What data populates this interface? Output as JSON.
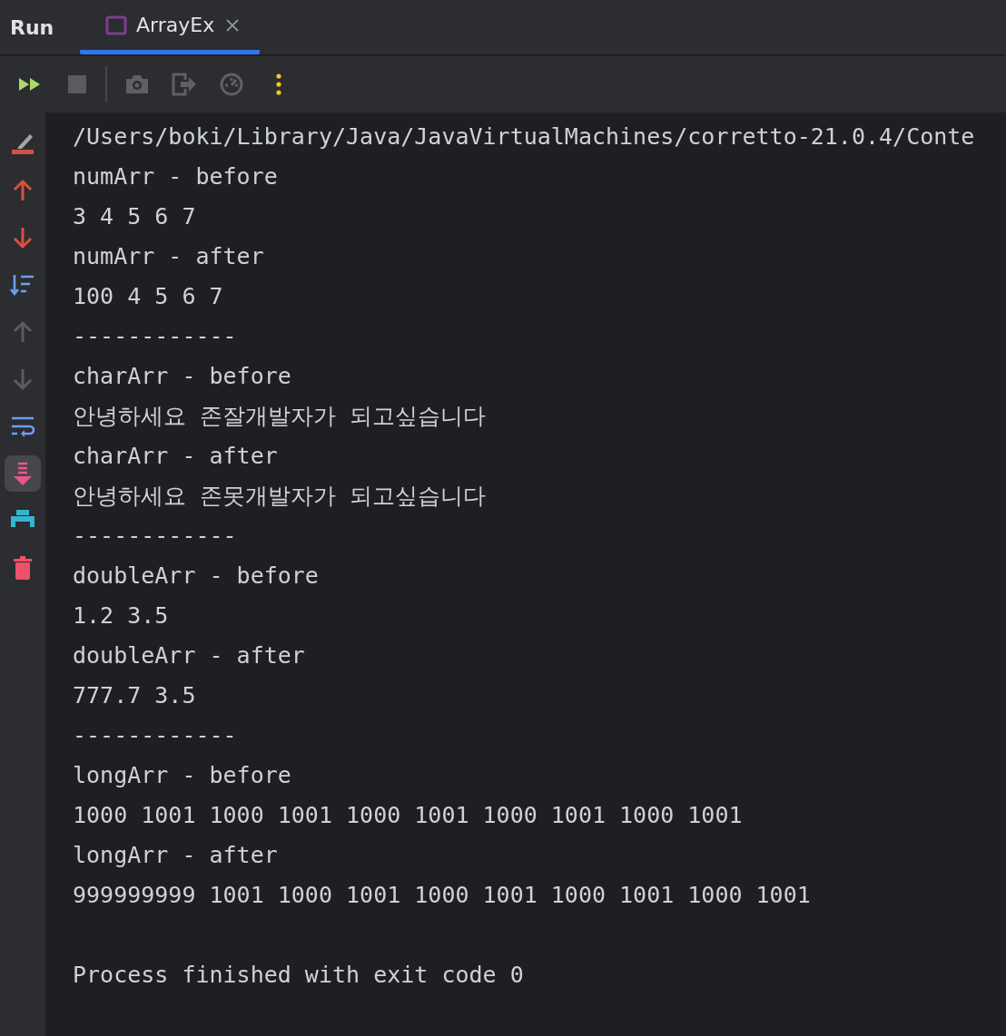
{
  "header": {
    "title": "Run",
    "tabs": [
      {
        "label": "ArrayEx",
        "selected": true
      }
    ]
  },
  "toolbar": [
    {
      "kind": "rerun",
      "disabled": false
    },
    {
      "kind": "stop",
      "disabled": true
    },
    {
      "kind": "camera",
      "disabled": true
    },
    {
      "kind": "exit",
      "disabled": true
    },
    {
      "kind": "gauge",
      "disabled": true
    },
    {
      "kind": "more",
      "disabled": false
    }
  ],
  "sidebar": [
    {
      "kind": "clear-marker",
      "disabled": false,
      "selected": false
    },
    {
      "kind": "up",
      "disabled": false,
      "selected": false
    },
    {
      "kind": "down",
      "disabled": false,
      "selected": false
    },
    {
      "kind": "sort",
      "disabled": false,
      "selected": false
    },
    {
      "kind": "prev",
      "disabled": true,
      "selected": false
    },
    {
      "kind": "next",
      "disabled": true,
      "selected": false
    },
    {
      "kind": "wrap",
      "disabled": false,
      "selected": false
    },
    {
      "kind": "scroll-end",
      "disabled": false,
      "selected": true
    },
    {
      "kind": "print",
      "disabled": false,
      "selected": false
    },
    {
      "kind": "trash",
      "disabled": false,
      "selected": false
    }
  ],
  "console": {
    "lines": [
      "/Users/boki/Library/Java/JavaVirtualMachines/corretto-21.0.4/Conte",
      "numArr - before",
      "3 4 5 6 7",
      "numArr - after",
      "100 4 5 6 7",
      "------------",
      "charArr - before",
      "안녕하세요 존잘개발자가 되고싶습니다",
      "charArr - after",
      "안녕하세요 존못개발자가 되고싶습니다",
      "------------",
      "doubleArr - before",
      "1.2 3.5",
      "doubleArr - after",
      "777.7 3.5",
      "------------",
      "longArr - before",
      "1000 1001 1000 1001 1000 1001 1000 1001 1000 1001",
      "longArr - after",
      "999999999 1001 1000 1001 1000 1001 1000 1001 1000 1001"
    ],
    "exit_message": "Process finished with exit code 0"
  }
}
